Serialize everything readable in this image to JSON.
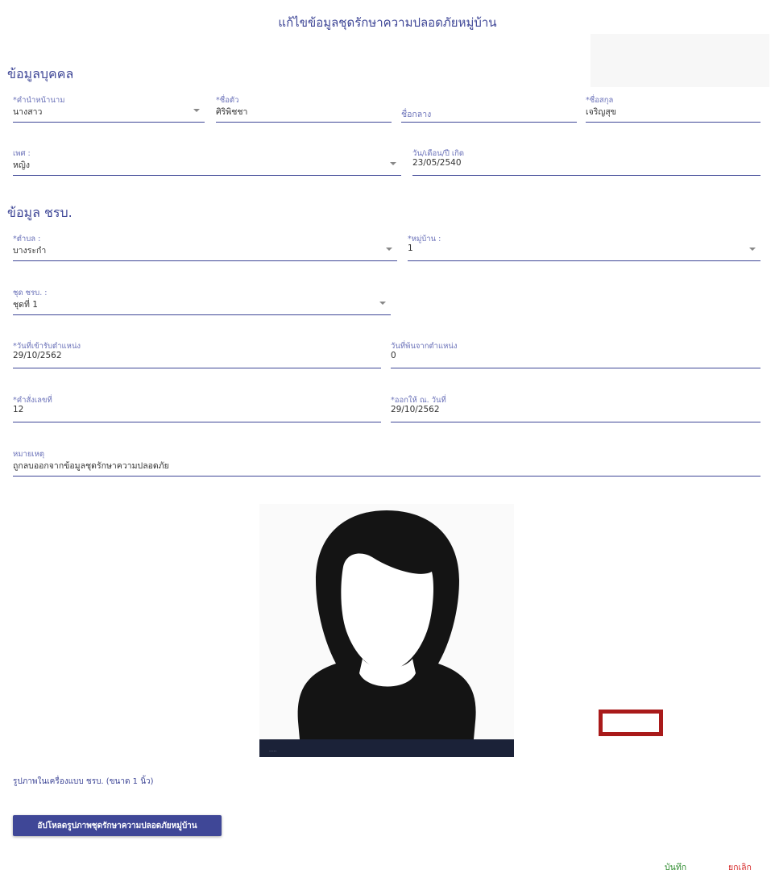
{
  "page": {
    "title": "แก้ไขข้อมูลชุดรักษาความปลอดภัยหมู่บ้าน"
  },
  "personal": {
    "section_title": "ข้อมูลบุคคล",
    "prefix": {
      "label": "*คำนำหน้านาม",
      "value": "นางสาว"
    },
    "first_name": {
      "label": "*ชื่อตัว",
      "value": "ศิริพิชชา"
    },
    "middle_name": {
      "placeholder": "ชื่อกลาง"
    },
    "last_name": {
      "label": "*ชื่อสกุล",
      "value": "เจริญสุข"
    },
    "gender": {
      "label": "เพศ :",
      "value": "หญิง"
    },
    "birthdate": {
      "label": "วัน/เดือน/ปี เกิด",
      "value": "23/05/2540"
    }
  },
  "chorabo": {
    "section_title": "ข้อมูล ชรบ.",
    "subdistrict": {
      "label": "*ตำบล :",
      "value": "บางระกำ"
    },
    "village": {
      "label": "*หมู่บ้าน :",
      "value": "1"
    },
    "team": {
      "label": "ชุด ชรบ. :",
      "value": "ชุดที่ 1"
    },
    "start_date": {
      "label": "*วันที่เข้ารับตำแหน่ง",
      "value": "29/10/2562"
    },
    "end_date": {
      "label": "วันที่พ้นจากตำแหน่ง",
      "value": "0"
    },
    "order_no": {
      "label": "*คำสั่งเลขที่",
      "value": "12"
    },
    "issued_date": {
      "label": "*ออกให้ ณ. วันที่",
      "value": "29/10/2562"
    },
    "remark": {
      "label": "หมายเหตุ",
      "value": "ถูกลบออกจากข้อมูลชุดรักษาความปลอดภัย"
    }
  },
  "photo": {
    "caption": "รูปภาพในเครื่องแบบ ชรบ. (ขนาด 1 นิ้ว)",
    "upload_label": "อัปโหลดรูปภาพชุดรักษาความปลอดภัยหมู่บ้าน"
  },
  "actions": {
    "save_label": "บันทึก",
    "cancel_label": "ยกเลิก"
  },
  "colors": {
    "primary": "#3f4797",
    "save": "#2e8b2e",
    "cancel": "#d62b2b",
    "highlight": "#a91a1a"
  }
}
